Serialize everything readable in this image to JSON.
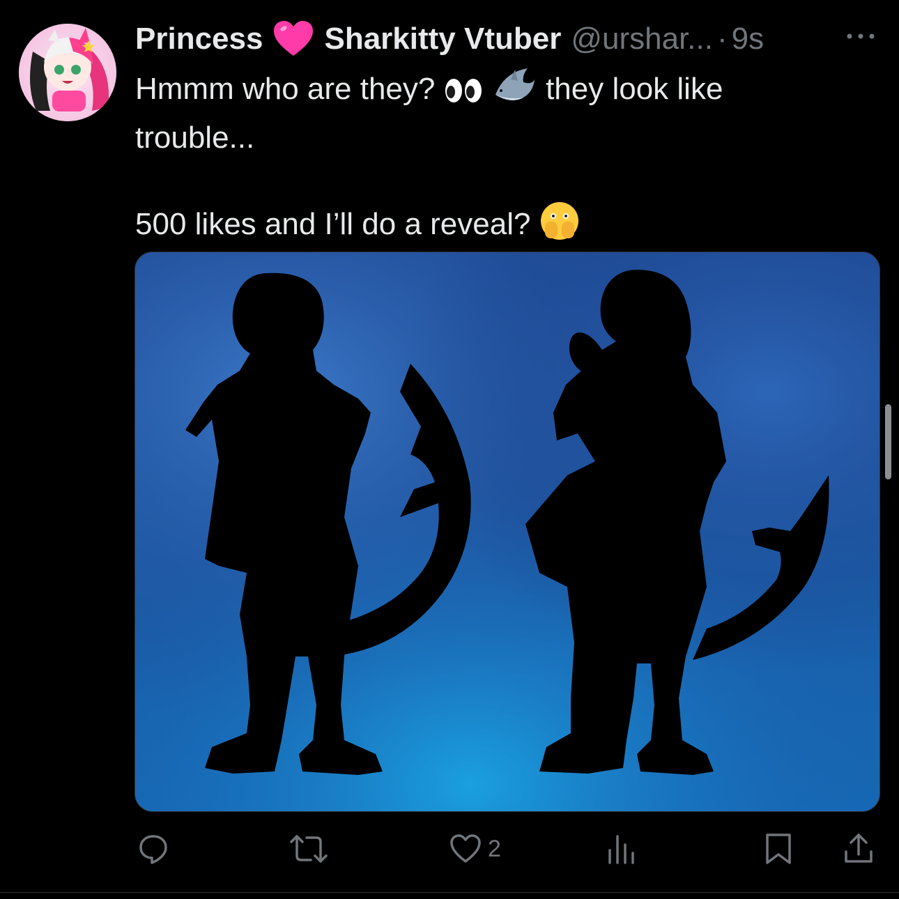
{
  "tweet": {
    "display_name_first": "Princess",
    "display_name_second": "Sharkitty Vtuber",
    "handle": "@urshar...",
    "separator": "·",
    "time": "9s",
    "text_line1_part1": "Hmmm who are they?",
    "text_line1_part2": "they look like",
    "text_line2": "trouble...",
    "text_line3": "500 likes and I’ll do a reveal?",
    "emojis": [
      "pink-heart",
      "eyes",
      "shark",
      "face-with-open-eyes-and-hand-over-mouth"
    ]
  },
  "actions": {
    "reply_count": "",
    "repost_count": "",
    "like_count": "2",
    "views_count": ""
  },
  "colors": {
    "background": "#000000",
    "text": "#e7e9ea",
    "muted": "#71767b",
    "media_blue": "#1f5fb0"
  }
}
